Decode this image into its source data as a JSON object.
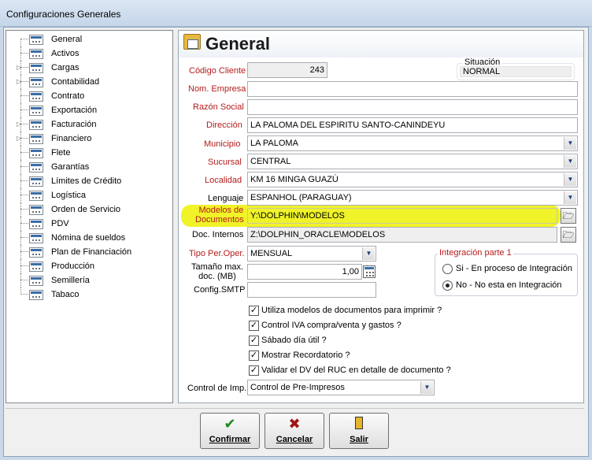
{
  "window": {
    "title": "Configuraciones Generales"
  },
  "tree": {
    "items": [
      {
        "label": "General",
        "expandable": false
      },
      {
        "label": "Activos",
        "expandable": false
      },
      {
        "label": "Cargas",
        "expandable": true
      },
      {
        "label": "Contabilidad",
        "expandable": true
      },
      {
        "label": "Contrato",
        "expandable": false
      },
      {
        "label": "Exportación",
        "expandable": false
      },
      {
        "label": "Facturación",
        "expandable": true
      },
      {
        "label": "Financiero",
        "expandable": true
      },
      {
        "label": "Flete",
        "expandable": false
      },
      {
        "label": "Garantías",
        "expandable": false
      },
      {
        "label": "Límites de Crédito",
        "expandable": false
      },
      {
        "label": "Logística",
        "expandable": false
      },
      {
        "label": "Orden de Servicio",
        "expandable": false
      },
      {
        "label": "PDV",
        "expandable": false
      },
      {
        "label": "Nómina de sueldos",
        "expandable": false
      },
      {
        "label": "Plan de Financiación",
        "expandable": false
      },
      {
        "label": "Producción",
        "expandable": false
      },
      {
        "label": "Semillería",
        "expandable": false
      },
      {
        "label": "Tabaco",
        "expandable": false
      }
    ]
  },
  "panel": {
    "title": "General",
    "codigo_cliente": {
      "label": "Código Cliente",
      "value": "243"
    },
    "situacion": {
      "label": "Situación",
      "value": "NORMAL"
    },
    "nom_empresa": {
      "label": "Nom. Empresa",
      "value": ""
    },
    "razon_social": {
      "label": "Razón Social",
      "value": ""
    },
    "direccion": {
      "label": "Dirección",
      "value": "LA PALOMA DEL ESPIRITU SANTO-CANINDEYU"
    },
    "municipio": {
      "label": "Municipio",
      "value": "LA PALOMA"
    },
    "sucursal": {
      "label": "Sucursal",
      "value": "CENTRAL"
    },
    "localidad": {
      "label": "Localidad",
      "value": "KM 16 MINGA GUAZÚ"
    },
    "lenguaje": {
      "label": "Lenguaje",
      "value": "ESPANHOL (PARAGUAY)"
    },
    "modelos": {
      "label1": "Modelos de",
      "label2": "Documentos",
      "value": "Y:\\DOLPHIN\\MODELOS"
    },
    "doc_internos": {
      "label": "Doc. Internos",
      "value": "Z:\\DOLPHIN_ORACLE\\MODELOS"
    },
    "tipo_per": {
      "label": "Tipo Per.Oper.",
      "value": "MENSUAL"
    },
    "tamano": {
      "label1": "Tamaño max.",
      "label2": "doc. (MB)",
      "value": "1,00"
    },
    "config_smtp": {
      "label": "Config.SMTP",
      "value": ""
    },
    "integracion": {
      "title": "Integración parte 1",
      "options": [
        "Si - En proceso de Integración",
        "No - No esta en Integración"
      ],
      "selected_index": 1
    },
    "checks": [
      {
        "label": "Utiliza modelos de documentos para imprimir ?",
        "checked": true
      },
      {
        "label": "Control IVA compra/venta y gastos ?",
        "checked": true
      },
      {
        "label": "Sábado día útil ?",
        "checked": true
      },
      {
        "label": "Mostrar Recordatorio ?",
        "checked": true
      },
      {
        "label": "Validar el DV del RUC en detalle de documento ?",
        "checked": true
      }
    ],
    "control_imp": {
      "label": "Control de Imp.",
      "value": "Control de Pre-Impresos"
    }
  },
  "buttons": {
    "confirmar": "Confirmar",
    "cancelar": "Cancelar",
    "salir": "Salir"
  },
  "colors": {
    "required_label": "#b51b1b",
    "highlight": "#eef21c",
    "confirm_icon": "#1a8a1a",
    "cancel_icon": "#a01515"
  },
  "icons": {
    "tree_item": "grid-icon",
    "folder": "folder-open-icon",
    "calculator": "calculator-icon",
    "confirm": "checkmark-icon",
    "cancel": "x-icon",
    "exit": "door-icon"
  }
}
